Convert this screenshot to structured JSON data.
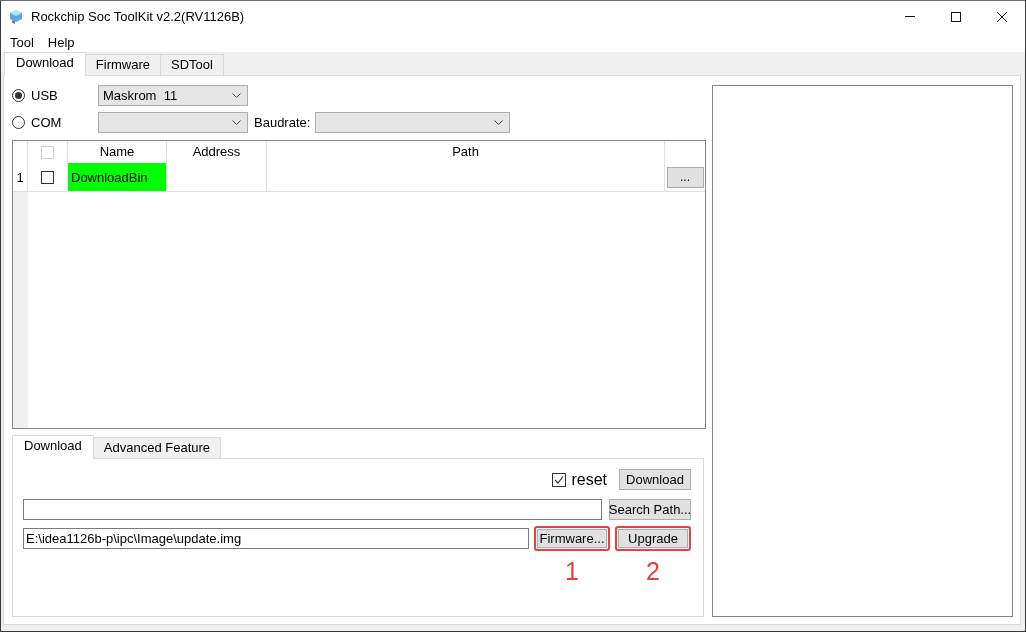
{
  "window": {
    "title": "Rockchip Soc ToolKit v2.2(RV1126B)"
  },
  "menu": [
    "Tool",
    "Help"
  ],
  "tabs": [
    {
      "label": "Download",
      "selected": true
    },
    {
      "label": "Firmware",
      "selected": false
    },
    {
      "label": "SDTool",
      "selected": false
    }
  ],
  "connection": [
    {
      "label": "USB",
      "selected": true
    },
    {
      "label": "COM",
      "selected": false
    }
  ],
  "device_dropdown": {
    "value": "Maskrom  11"
  },
  "baudrate": {
    "label": "Baudrate:"
  },
  "table": {
    "select_all": {
      "checked": false,
      "disabled": true
    },
    "columns": [
      "Name",
      "Address",
      "Path"
    ],
    "rows": [
      {
        "number": "1",
        "checked": false,
        "name": "DownloadBin",
        "color": "#00ff00",
        "browse_button": "..."
      }
    ]
  },
  "bottom_tabs": [
    {
      "label": "Download",
      "selected": true
    },
    {
      "label": "Advanced Feature",
      "selected": false
    }
  ],
  "download_panel": {
    "reset": {
      "label": "reset",
      "checked": true
    },
    "download_button": "Download",
    "search_button": "Search Path...",
    "firmware_path": {
      "value": "E:\\idea1126b-p\\ipc\\Image\\update.img"
    },
    "action_buttons": [
      {
        "label": "Firmware...",
        "highlighted": true,
        "step": "1"
      },
      {
        "label": "Upgrade",
        "highlighted": true,
        "step": "2"
      }
    ]
  }
}
